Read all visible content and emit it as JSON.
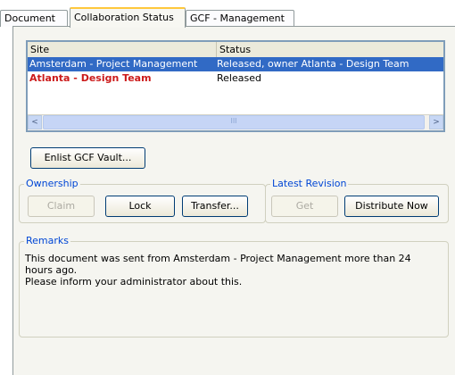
{
  "tabs": [
    {
      "label": "Document"
    },
    {
      "label": "Collaboration Status"
    },
    {
      "label": "GCF - Management"
    }
  ],
  "site_list": {
    "columns": [
      "Site",
      "Status"
    ],
    "rows": [
      {
        "site": "Amsterdam - Project Management",
        "status": "Released, owner Atlanta - Design Team",
        "selected": true
      },
      {
        "site": "Atlanta - Design Team",
        "status": "Released",
        "selected": false
      }
    ],
    "scroll_left": "<",
    "scroll_right": ">",
    "scroll_thumb": "III"
  },
  "buttons": {
    "enlist": "Enlist GCF Vault...",
    "claim": "Claim",
    "lock": "Lock",
    "transfer": "Transfer...",
    "get": "Get",
    "distribute": "Distribute Now"
  },
  "groups": {
    "ownership": "Ownership",
    "latest_revision": "Latest Revision",
    "remarks": "Remarks"
  },
  "remarks_text": "This document was sent from Amsterdam - Project Management more than 24\nhours ago.\nPlease inform your administrator about this."
}
